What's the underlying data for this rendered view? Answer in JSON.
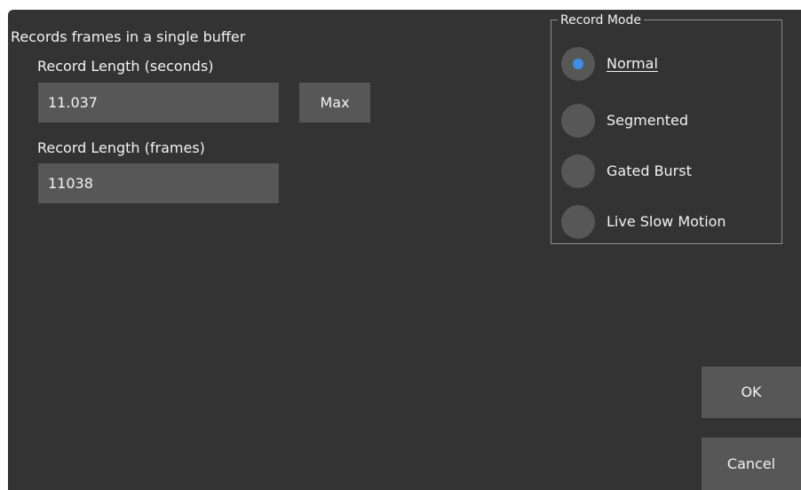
{
  "dialog": {
    "description": "Records frames in a single buffer",
    "record_length_seconds": {
      "label": "Record Length (seconds)",
      "value": "11.037"
    },
    "max_button_label": "Max",
    "record_length_frames": {
      "label": "Record Length (frames)",
      "value": "11038"
    },
    "record_mode": {
      "title": "Record Mode",
      "options": [
        {
          "label": "Normal",
          "selected": true
        },
        {
          "label": "Segmented",
          "selected": false
        },
        {
          "label": "Gated Burst",
          "selected": false
        },
        {
          "label": "Live Slow Motion",
          "selected": false
        }
      ]
    },
    "ok_label": "OK",
    "cancel_label": "Cancel"
  },
  "colors": {
    "background": "#333333",
    "control": "#575757",
    "accent": "#3d8ee6",
    "text": "#f2f2f2"
  }
}
